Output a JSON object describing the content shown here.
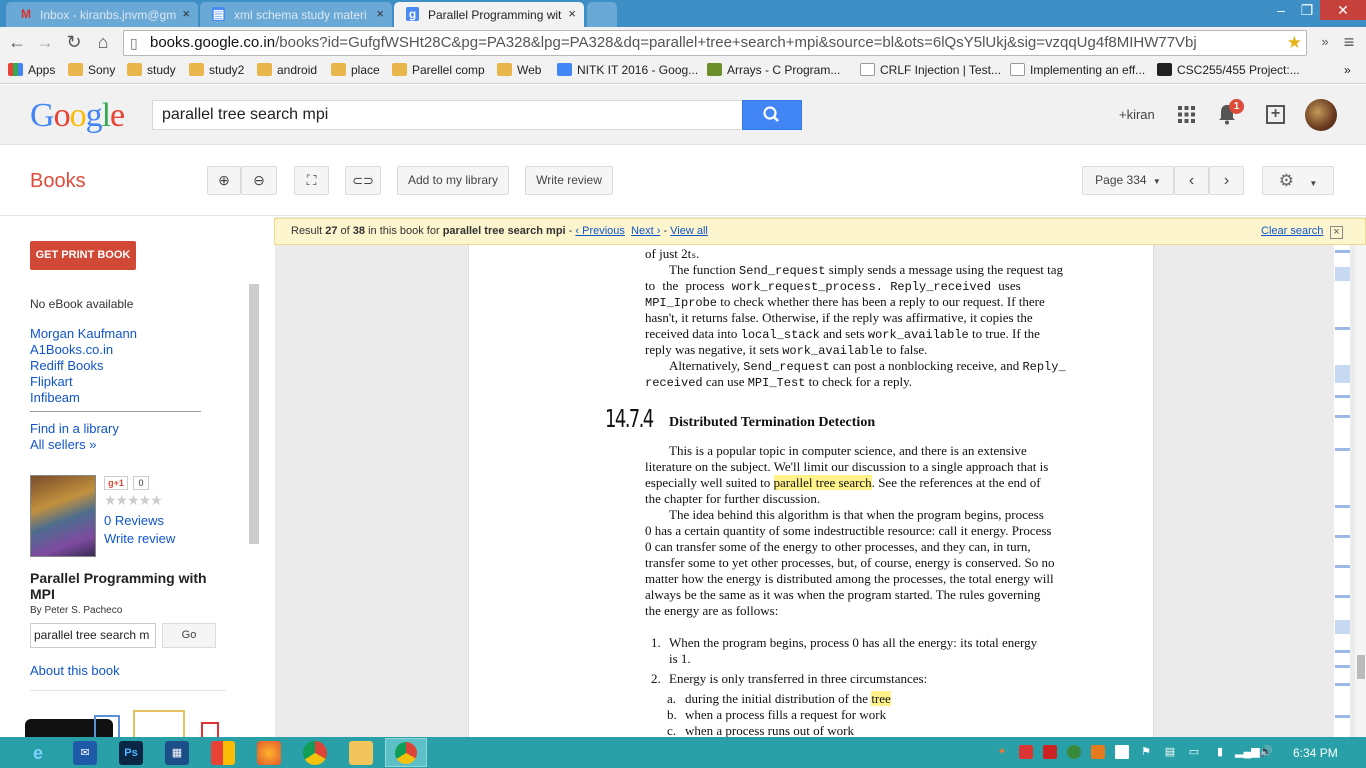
{
  "browser": {
    "tabs": [
      {
        "title": "Inbox - kiranbs.jnvm@gm",
        "icon": "gmail-icon",
        "active": false
      },
      {
        "title": "xml schema study materi",
        "icon": "docs-icon",
        "active": false
      },
      {
        "title": "Parallel Programming wit",
        "icon": "google-icon",
        "active": true
      }
    ],
    "url_host": "books.google.co.in",
    "url_path": "/books?id=GufgfWSHt28C&pg=PA328&lpg=PA328&dq=parallel+tree+search+mpi&source=bl&ots=6lQsY5lUkj&sig=vzqqUg4f8MIHW77Vbj",
    "bookmarks": [
      "Apps",
      "Sony",
      "study",
      "study2",
      "android",
      "place",
      "Parellel comp",
      "Web",
      "NITK IT 2016 - Goog...",
      "Arrays - C Program...",
      "CRLF Injection | Test...",
      "Implementing an eff...",
      "CSC255/455 Project:..."
    ],
    "bookmarks_more": "»"
  },
  "google_header": {
    "logo": "Google",
    "search_query": "parallel tree search mpi",
    "user": "+kiran",
    "notification_count": "1"
  },
  "books_toolbar": {
    "brand": "Books",
    "add_library": "Add to my library",
    "write_review": "Write review",
    "page_select": "Page 334"
  },
  "sidebar": {
    "get_print": "GET PRINT BOOK",
    "no_ebook": "No eBook available",
    "sellers": [
      "Morgan Kaufmann",
      "A1Books.co.in",
      "Rediff Books",
      "Flipkart",
      "Infibeam"
    ],
    "find_library": "Find in a library",
    "all_sellers": "All sellers »",
    "gplus": "g+1",
    "gplus_count": "0",
    "reviews": "0 Reviews",
    "write_review": "Write review",
    "book_title": "Parallel Programming with MPI",
    "author": "By Peter S. Pacheco",
    "inbook_search": "parallel tree search m",
    "go": "Go",
    "about": "About this book"
  },
  "result_bar": {
    "prefix": "Result ",
    "index": "27",
    "of": " of ",
    "total": "38",
    "middle": " in this book for ",
    "query": "parallel tree search mpi",
    "sep1": " - ",
    "previous": "‹ Previous",
    "next": "Next ›",
    "sep2": " - ",
    "view_all": "View all",
    "clear": "Clear search"
  },
  "page_text": {
    "line_top": "of just 2tₛ.",
    "p1": [
      {
        "a": "The function ",
        "m": "Send_request",
        "b": " simply sends a message using the request tag"
      },
      {
        "a": "to the process ",
        "m": "work_request_process.",
        "b": "   ",
        "m2": "Reply_received",
        "c": " uses"
      },
      {
        "m": "MPI_Iprobe",
        "b": " to check whether there has been a reply to our request. If there"
      },
      {
        "a": "hasn't, it returns false. Otherwise, if the reply was affirmative, it copies the"
      },
      {
        "a": "received data into ",
        "m": "local_stack",
        "b": " and sets ",
        "m2": "work_available",
        "c": " to true. If the"
      },
      {
        "a": "reply was negative, it sets ",
        "m": "work_available",
        "b": " to false."
      }
    ],
    "p2": [
      {
        "a": "Alternatively, ",
        "m": "Send_request",
        "b": " can post a nonblocking receive, and ",
        "m2": "Reply_"
      },
      {
        "m": "received",
        "b": " can use ",
        "m2": "MPI_Test",
        "c": " to check for a reply."
      }
    ],
    "section_num": "14.7.4",
    "section_title": "Distributed Termination Detection",
    "p3": [
      {
        "a": "This is a popular topic in computer science, and there is an extensive"
      },
      {
        "a": "literature on the subject. We'll limit our discussion to a single approach that is"
      },
      {
        "a": "especially well suited to ",
        "h": "parallel tree search",
        "b": ". See the references at the end of"
      },
      {
        "a": "the chapter for further discussion."
      }
    ],
    "p4": [
      {
        "a": "The idea behind this algorithm is that when the program begins, process"
      },
      {
        "a": "0 has a certain quantity of some indestructible resource: call it energy. Process"
      },
      {
        "a": "0 can transfer some of the energy to other processes, and they can, in turn,"
      },
      {
        "a": "transfer some to yet other processes, but, of course, energy is conserved. So no"
      },
      {
        "a": "matter how the energy is distributed among the processes, the total energy will"
      },
      {
        "a": "always be the same as it was when the program started. The rules governing"
      },
      {
        "a": "the energy are as follows:"
      }
    ],
    "list1_num": "1.",
    "list1_a": "When the program begins, process 0 has all the energy: its total energy",
    "list1_b": "is 1.",
    "list2_num": "2.",
    "list2": "Energy is only transferred in three circumstances:",
    "sub_a_num": "a.",
    "sub_a_pre": "during the initial distribution of the ",
    "sub_a_hl": "tree",
    "sub_b_num": "b.",
    "sub_b": "when a process fills a request for work",
    "sub_c_num": "c.",
    "sub_c": "when a process runs out of work"
  },
  "taskbar": {
    "apps": [
      "ie-icon",
      "outlook-icon",
      "photoshop-icon",
      "network-icon",
      "office-icon",
      "firefox-icon",
      "chrome-icon",
      "explorer-icon",
      "chrome-active-icon"
    ],
    "time": "6:34 PM"
  },
  "colors": {
    "accent_blue": "#4285f4",
    "books_red": "#dd4b39",
    "titlebar": "#3d8fc6",
    "taskbar": "#29a0a7",
    "highlight": "#fff28a"
  }
}
